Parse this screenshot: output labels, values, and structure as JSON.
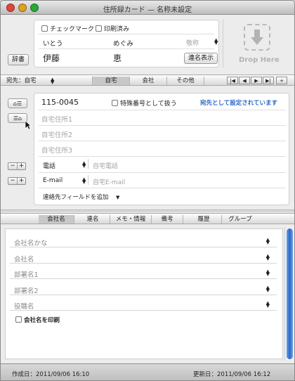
{
  "window": {
    "title": "住所録カード — 名称未設定"
  },
  "name_panel": {
    "check_mark_label": "チェックマーク",
    "printed_label": "印刷済み",
    "last_kana": "いとう",
    "first_kana": "めぐみ",
    "honorific_placeholder": "敬称",
    "last_name": "伊藤",
    "first_name": "恵",
    "joint_name_button": "連名表示",
    "dictionary_button": "辞書",
    "drop_label": "Drop Here"
  },
  "address_bar": {
    "destination_label": "宛先：自宅",
    "tabs": [
      "自宅",
      "会社",
      "その他"
    ],
    "nav_buttons": [
      "|◀",
      "◀",
      "▶",
      "▶|",
      "+"
    ]
  },
  "address_panel": {
    "postal_code": "115-0045",
    "special_number_label": "特殊番号として扱う",
    "destination_status": "宛先として設定されています",
    "address_placeholders": [
      "自宅住所1",
      "自宅住所2",
      "自宅住所3"
    ],
    "phone_type": "電話",
    "phone_placeholder": "自宅電話",
    "email_type": "E-mail",
    "email_placeholder": "自宅E-mail",
    "add_field_label": "連絡先フィールドを追加"
  },
  "lower_tabs": [
    "会社名",
    "連名",
    "メモ・情報",
    "備考",
    "履歴",
    "グループ"
  ],
  "company_fields": [
    "会社名かな",
    "会社名",
    "部署名1",
    "部署名2",
    "役職名"
  ],
  "print_company_label": "会社名を印刷",
  "status_bar": {
    "created": "作成日：2011/09/06 16:10",
    "updated": "更新日：2011/09/06 16:12"
  },
  "colors": {
    "accent": "#2a67c9",
    "close": "#e0443e",
    "minimize": "#dea123",
    "zoom": "#27aa35"
  }
}
